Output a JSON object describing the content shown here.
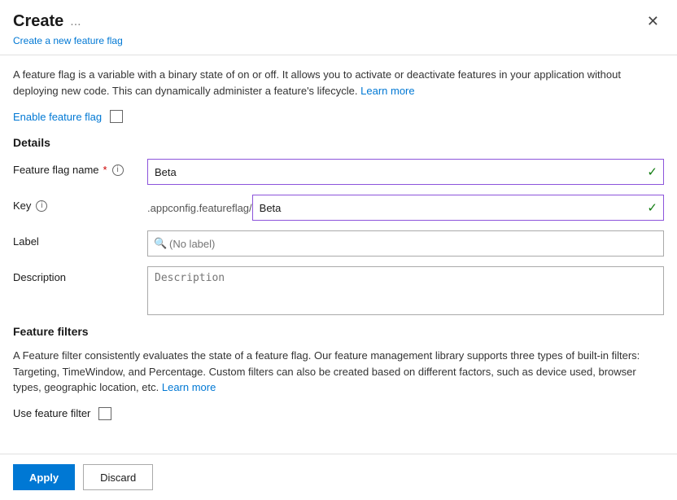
{
  "dialog": {
    "title": "Create",
    "ellipsis": "...",
    "subtitle": "Create a new feature flag"
  },
  "info_text": "A feature flag is a variable with a binary state of on or off. It allows you to activate or deactivate features in your application without deploying new code. This can dynamically administer a feature's lifecycle.",
  "info_text_link": "Learn more",
  "enable_flag_label": "Enable feature flag",
  "details_section_title": "Details",
  "fields": {
    "flag_name_label": "Feature flag name",
    "flag_name_required": "*",
    "flag_name_value": "Beta",
    "key_label": "Key",
    "key_prefix": ".appconfig.featureflag/",
    "key_value": "Beta",
    "label_label": "Label",
    "label_placeholder": "(No label)",
    "description_label": "Description",
    "description_placeholder": "Description"
  },
  "feature_filters": {
    "section_title": "Feature filters",
    "info_text": "A Feature filter consistently evaluates the state of a feature flag. Our feature management library supports three types of built-in filters: Targeting, TimeWindow, and Percentage. Custom filters can also be created based on different factors, such as device used, browser types, geographic location, etc.",
    "info_text_link": "Learn more",
    "use_filter_label": "Use feature filter"
  },
  "footer": {
    "apply_label": "Apply",
    "discard_label": "Discard"
  },
  "icons": {
    "close": "✕",
    "check": "✓",
    "search": "🔍",
    "info": "i"
  }
}
